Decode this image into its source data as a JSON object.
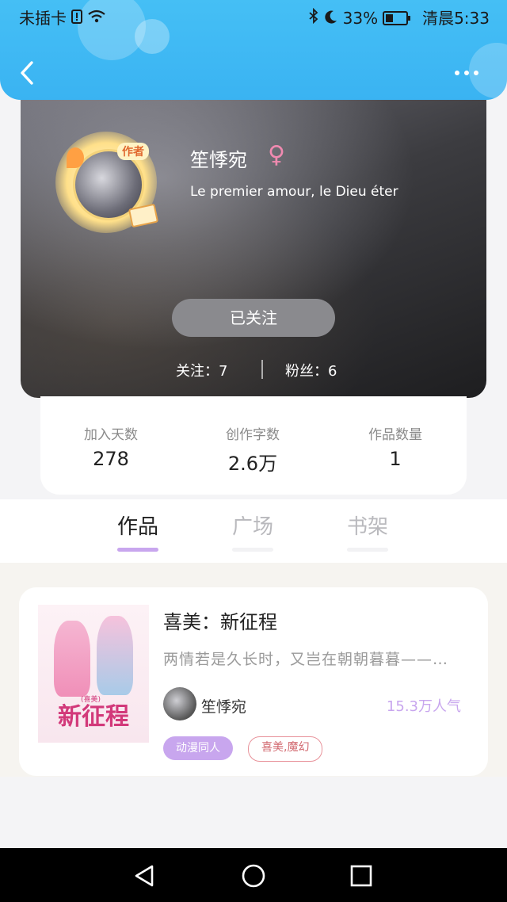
{
  "status_bar": {
    "carrier": "未插卡",
    "battery": "33%",
    "time": "清晨5:33"
  },
  "profile": {
    "name": "笙悸宛",
    "bio": "Le premier amour, le Dieu éter",
    "avatar_badge": "作者",
    "follow_button": "已关注",
    "following_label": "关注：7",
    "fans_label": "粉丝：6"
  },
  "stats": {
    "days_label": "加入天数",
    "days_value": "278",
    "words_label": "创作字数",
    "words_value": "2.6万",
    "works_label": "作品数量",
    "works_value": "1"
  },
  "tabs": {
    "works": "作品",
    "square": "广场",
    "shelf": "书架"
  },
  "work": {
    "title": "喜美：新征程",
    "description": "两情若是久长时，又岂在朝朝暮暮——…",
    "author": "笙悸宛",
    "popularity": "15.3万人气",
    "tag_category": "动漫同人",
    "tag_topics": "喜美,魔幻",
    "cover_title": "新征程",
    "cover_subtitle": "(喜美)"
  },
  "colors": {
    "header_blue": "#45bff5",
    "accent_purple": "#c8a6ee",
    "gender_pink": "#f08ab0"
  },
  "icons": [
    "back-arrow",
    "more-dots",
    "bluetooth",
    "moon",
    "wifi",
    "battery",
    "female-symbol",
    "nav-back",
    "nav-home",
    "nav-recent"
  ]
}
